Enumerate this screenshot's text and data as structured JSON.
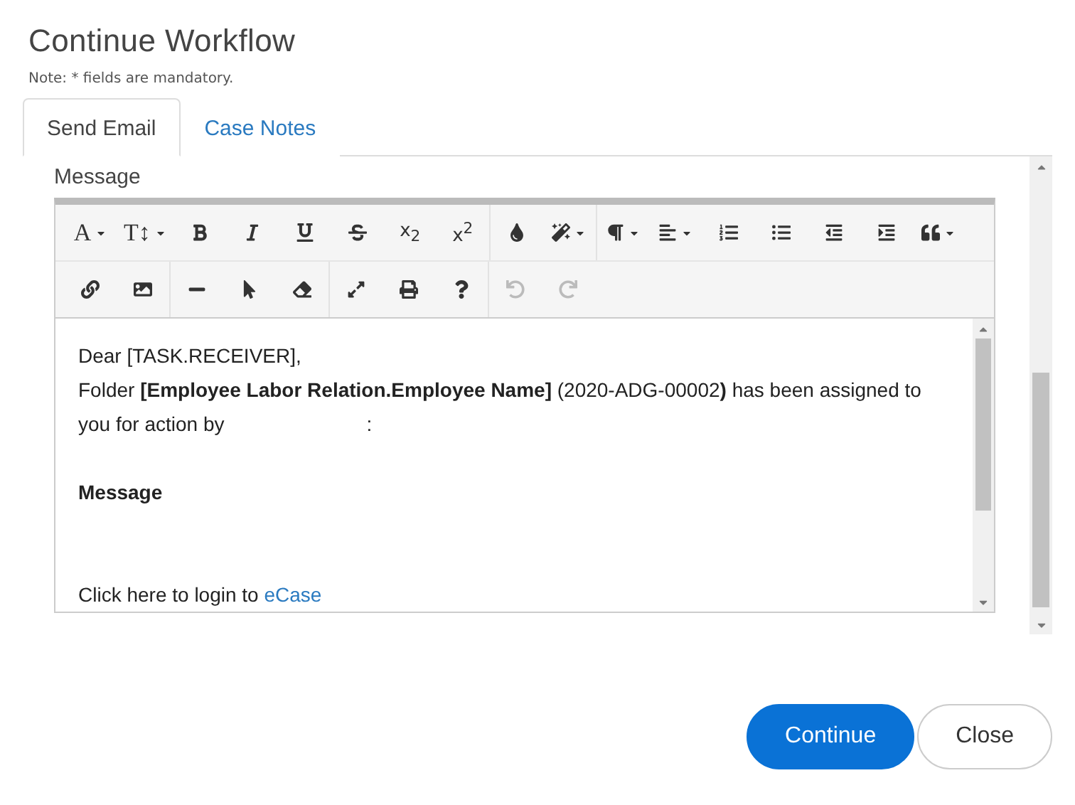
{
  "dialog": {
    "title": "Continue Workflow",
    "note": "Note: * fields are mandatory."
  },
  "tabs": [
    {
      "label": "Send Email",
      "selected": true
    },
    {
      "label": "Case Notes",
      "selected": false
    }
  ],
  "message": {
    "label": "Message",
    "toolbar": [
      [
        [
          {
            "kind": "glyph",
            "label": "A",
            "dropdown": true
          },
          {
            "kind": "glyph",
            "label": "T↕",
            "dropdown": true
          },
          {
            "kind": "icon",
            "dropdown": false
          },
          {
            "kind": "icon",
            "dropdown": false
          },
          {
            "kind": "icon",
            "dropdown": false
          },
          {
            "kind": "icon",
            "dropdown": false
          },
          {
            "kind": "glyph",
            "label": "x$_{2}$",
            "dropdown": false
          },
          {
            "kind": "glyph",
            "label": "x$^{2}$",
            "dropdown": false
          }
        ],
        [
          {
            "kind": "icon",
            "dropdown": false
          },
          {
            "kind": "icon",
            "dropdown": true
          }
        ],
        [
          {
            "kind": "icon",
            "dropdown": true
          },
          {
            "kind": "icon",
            "dropdown": true
          },
          {
            "kind": "icon",
            "dropdown": false
          },
          {
            "kind": "icon",
            "dropdown": false
          },
          {
            "kind": "icon",
            "dropdown": false
          },
          {
            "kind": "icon",
            "dropdown": false
          },
          {
            "kind": "icon",
            "dropdown": true
          }
        ]
      ],
      [
        [
          {
            "kind": "icon",
            "dropdown": false
          },
          {
            "kind": "icon",
            "dropdown": false
          }
        ],
        [
          {
            "kind": "icon",
            "dropdown": false
          },
          {
            "kind": "icon",
            "dropdown": false
          },
          {
            "kind": "icon",
            "dropdown": false
          }
        ],
        [
          {
            "kind": "icon",
            "dropdown": false
          },
          {
            "kind": "icon",
            "dropdown": false
          },
          {
            "kind": "icon",
            "dropdown": false
          }
        ],
        [
          {
            "kind": "icon",
            "dropdown": false,
            "disabled": true
          },
          {
            "kind": "icon",
            "dropdown": false,
            "disabled": true
          }
        ]
      ]
    ],
    "body": [
      {
        "kind": "text",
        "text": "Dear [TASK.RECEIVER],"
      },
      {
        "kind": "redacted",
        "text": "Folder **[Employee Labor Relation.Employee Name]** (2020-ADG-00002**)** has been assigned to you for action by",
        "after": ":"
      },
      {
        "kind": "blank"
      },
      {
        "kind": "heading",
        "text": "Message"
      },
      {
        "kind": "blank"
      },
      {
        "kind": "blank"
      },
      {
        "kind": "link",
        "text": "Click here to login to",
        "link": "eCase"
      }
    ]
  },
  "buttons": [
    {
      "label": "Continue",
      "primary": true
    },
    {
      "label": "Close",
      "primary": false
    }
  ]
}
